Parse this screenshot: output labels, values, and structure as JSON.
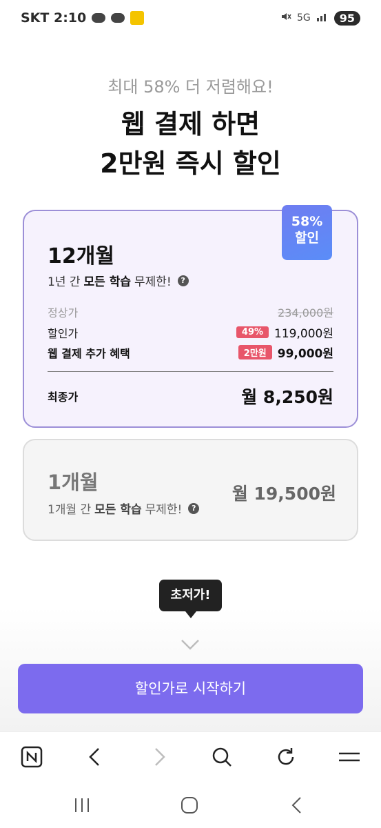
{
  "status_bar": {
    "time": "SKT 2:10",
    "battery": "95",
    "network": "5G"
  },
  "header": {
    "subtitle": "최대 58% 더 저렴해요!",
    "title_line1": "웹 결제 하면",
    "title_line2": "2만원 즉시 할인"
  },
  "plan_12": {
    "badge_line1": "58%",
    "badge_line2": "할인",
    "name": "12개월",
    "desc_prefix": "1년 간 ",
    "desc_bold": "모든 학습",
    "desc_suffix": " 무제한!",
    "rows": {
      "normal_label": "정상가",
      "normal_value": "234,000원",
      "discount_label": "할인가",
      "discount_tag": "49%",
      "discount_value": "119,000원",
      "web_label": "웹 결제 추가 혜택",
      "web_tag": "2만원",
      "web_value": "99,000원",
      "final_label": "최종가",
      "final_value": "월 8,250원"
    }
  },
  "plan_1": {
    "name": "1개월",
    "desc_prefix": "1개월 간 ",
    "desc_bold": "모든 학습",
    "desc_suffix": " 무제한!",
    "monthly": "월 19,500원"
  },
  "tooltip": "초저가!",
  "cta": "할인가로 시작하기",
  "colors": {
    "accent": "#7c6bee",
    "badge": "#5a8df8",
    "tag": "#e8566a",
    "selected_border": "#9c8fd7"
  },
  "icons": {
    "browser_toolbar": [
      "naver-n-icon",
      "back-icon",
      "forward-icon",
      "search-icon",
      "refresh-icon",
      "menu-icon"
    ],
    "system_nav": [
      "recent-apps-icon",
      "home-icon",
      "system-back-icon"
    ]
  }
}
